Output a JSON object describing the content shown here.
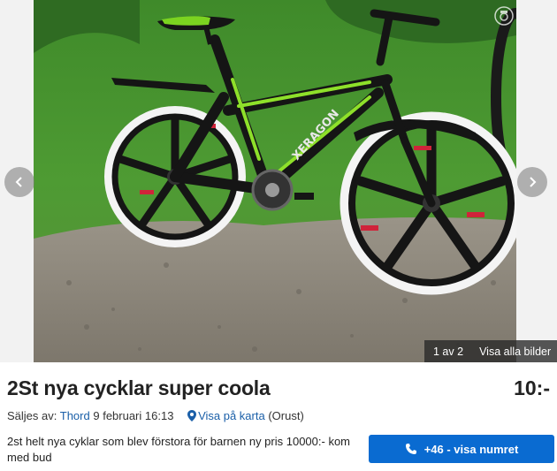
{
  "gallery": {
    "photo_alt": "",
    "counter": "1 av 2",
    "show_all_label": "Visa alla bilder",
    "prev_icon": "chevron-left-icon",
    "next_icon": "chevron-right-icon",
    "frame_text": "XERAGON"
  },
  "ad": {
    "title": "2St nya cycklar super coola",
    "price": "10:-",
    "seller_prefix": "Säljes av:",
    "seller_name": "Thord",
    "posted": "9 februari 16:13",
    "map_link": "Visa på karta",
    "location": "(Orust)",
    "description": "2st helt nya cyklar som blev förstora för barnen ny pris 10000:- kom med bud"
  },
  "contact": {
    "phone_label": "+46 - visa numret",
    "icon": "phone-icon"
  },
  "colors": {
    "link": "#1a5fa8",
    "primary_button": "#0a6bd1",
    "overlay": "#282828"
  }
}
